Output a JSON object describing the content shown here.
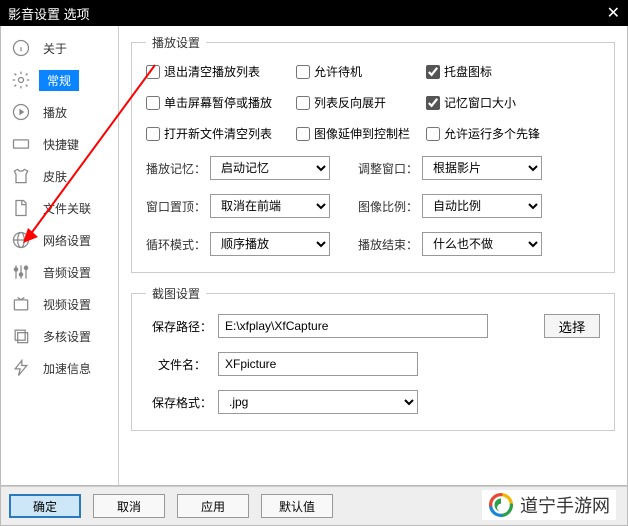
{
  "title": "影音设置 选项",
  "sidebar": {
    "items": [
      {
        "label": "关于"
      },
      {
        "label": "常规"
      },
      {
        "label": "播放"
      },
      {
        "label": "快捷键"
      },
      {
        "label": "皮肤"
      },
      {
        "label": "文件关联"
      },
      {
        "label": "网络设置"
      },
      {
        "label": "音频设置"
      },
      {
        "label": "视频设置"
      },
      {
        "label": "多核设置"
      },
      {
        "label": "加速信息"
      }
    ]
  },
  "play_group": {
    "legend": "播放设置",
    "checks": {
      "r1c1": "退出清空播放列表",
      "r1c2": "允许待机",
      "r1c3": "托盘图标",
      "r2c1": "单击屏幕暂停或播放",
      "r2c2": "列表反向展开",
      "r2c3": "记忆窗口大小",
      "r3c1": "打开新文件清空列表",
      "r3c2": "图像延伸到控制栏",
      "r3c3": "允许运行多个先锋"
    },
    "checked": {
      "r1c3": true,
      "r2c3": true
    },
    "labels": {
      "play_mem": "播放记忆：",
      "adjust_win": "调整窗口：",
      "win_top": "窗口置顶：",
      "img_ratio": "图像比例：",
      "loop_mode": "循环模式：",
      "play_end": "播放结束："
    },
    "values": {
      "play_mem": "启动记忆",
      "adjust_win": "根据影片",
      "win_top": "取消在前端",
      "img_ratio": "自动比例",
      "loop_mode": "顺序播放",
      "play_end": "什么也不做"
    }
  },
  "cap_group": {
    "legend": "截图设置",
    "labels": {
      "save_path": "保存路径：",
      "file_name": "文件名：",
      "save_fmt": "保存格式："
    },
    "values": {
      "save_path": "E:\\xfplay\\XfCapture",
      "file_name": "XFpicture",
      "save_fmt": ".jpg"
    },
    "browse": "选择"
  },
  "footer": {
    "ok": "确定",
    "cancel": "取消",
    "apply": "应用",
    "default": "默认值"
  },
  "brand": "道宁手游网"
}
